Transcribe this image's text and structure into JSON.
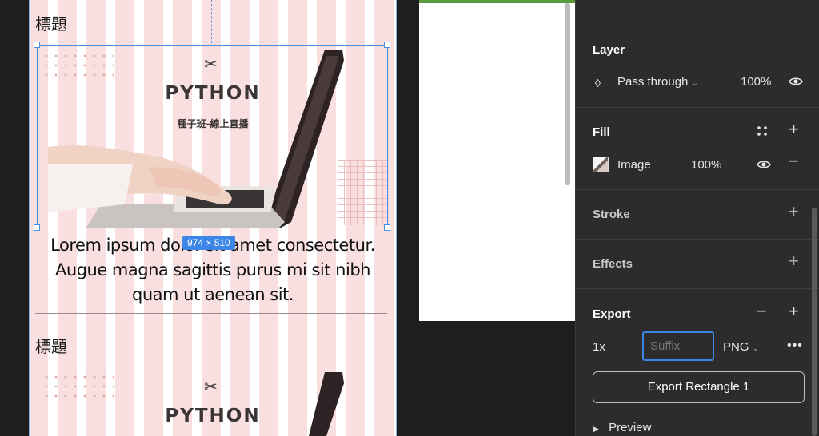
{
  "canvas": {
    "frame": {
      "section_title_1": "標題",
      "section_title_2": "標題",
      "banner": {
        "tool_icon": "wrench-screwdriver-icon",
        "title": "PYTHON",
        "subtitle": "種子班-線上直播"
      },
      "lorem_lines": [
        "Lorem ipsum dolor sit amet consectetur.",
        "Augue magna sagittis purus mi sit nibh",
        "quam ut aenean sit."
      ],
      "selection_dimensions": "974 × 510"
    }
  },
  "panel": {
    "layer": {
      "title": "Layer",
      "blend_mode": "Pass through",
      "opacity": "100%"
    },
    "fill": {
      "title": "Fill",
      "type": "Image",
      "opacity": "100%"
    },
    "stroke": {
      "title": "Stroke"
    },
    "effects": {
      "title": "Effects"
    },
    "export": {
      "title": "Export",
      "scale": "1x",
      "suffix_placeholder": "Suffix",
      "format": "PNG",
      "export_button": "Export Rectangle 1",
      "preview_label": "Preview"
    }
  },
  "colors": {
    "panel_bg": "#2c2c2c",
    "canvas_bg": "#1e1e1e",
    "selection": "#4a90e2",
    "layout_grid_column": "#f4c4c4",
    "frame_accent_bar": "#5a9b3d"
  }
}
